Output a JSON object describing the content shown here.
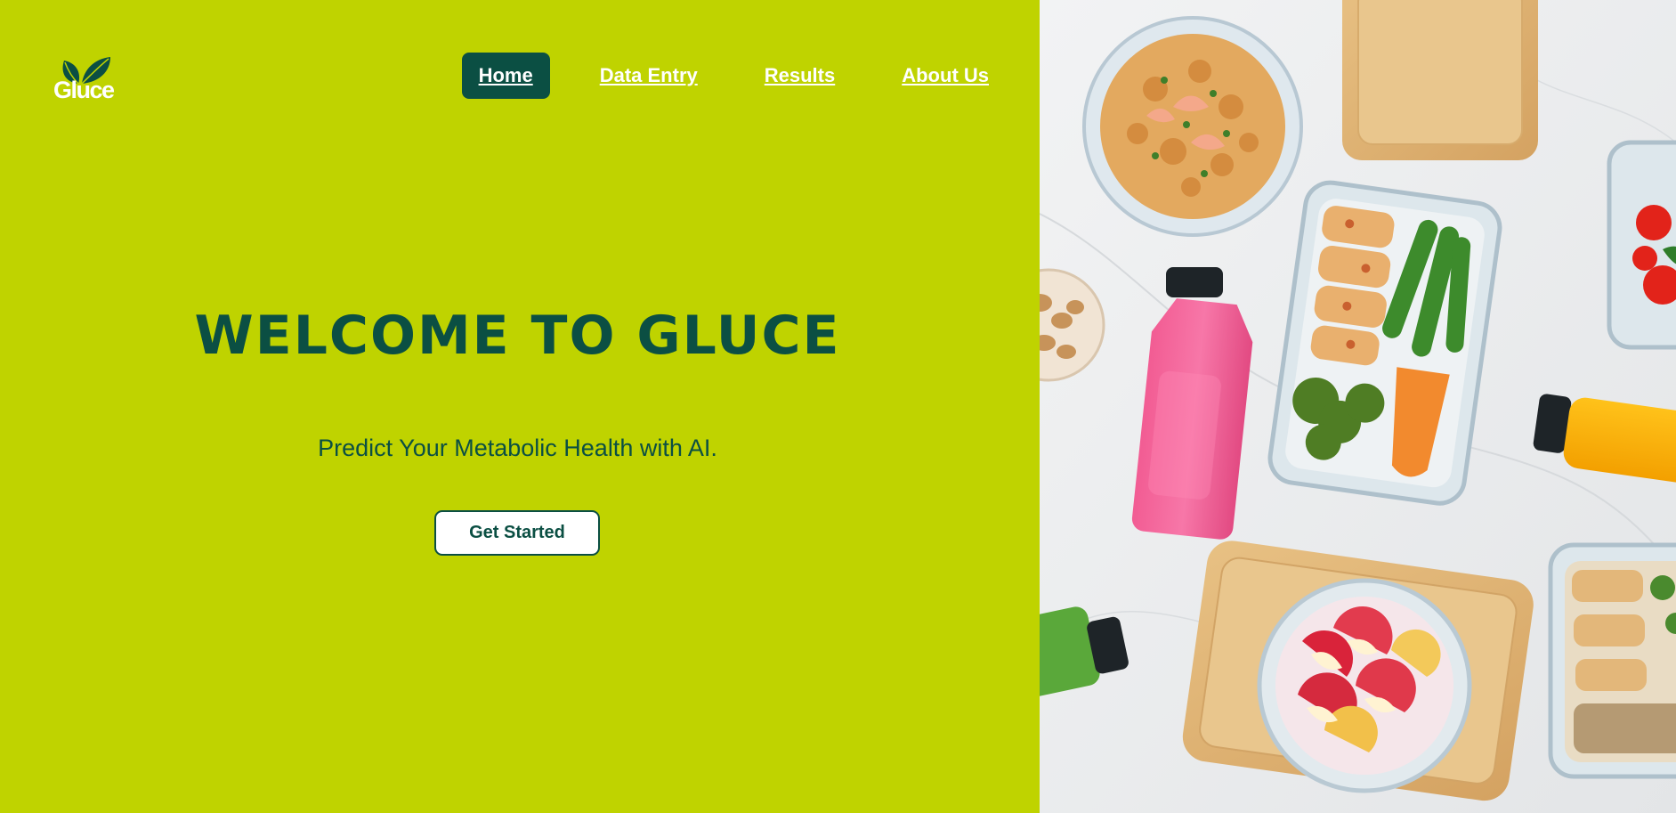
{
  "brand": {
    "name": "Gluce",
    "colors": {
      "background": "#bfd300",
      "primary": "#0b4f43",
      "white": "#ffffff"
    }
  },
  "nav": {
    "items": [
      {
        "label": "Home",
        "active": true
      },
      {
        "label": "Data Entry",
        "active": false
      },
      {
        "label": "Results",
        "active": false
      },
      {
        "label": "About Us",
        "active": false
      }
    ]
  },
  "hero": {
    "title": "WELCOME TO GLUCE",
    "subtitle": "Predict Your Metabolic Health with AI.",
    "cta_label": "Get Started"
  },
  "image": {
    "icon": "healthy-food-meal-prep-photo"
  }
}
